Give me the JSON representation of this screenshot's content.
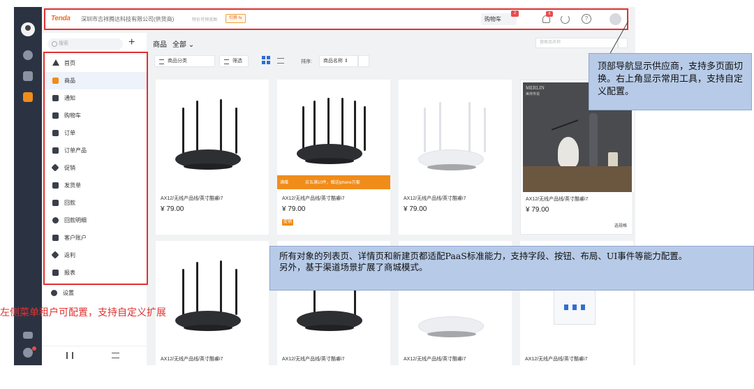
{
  "header": {
    "logo_text": "Tenda",
    "tenant_name": "深圳市吉祥腾达科技有限公司(供货商)",
    "tagline": "特价可预览图",
    "switch_label": "切换 ⇆",
    "cart_label": "购物车",
    "cart_count": "2",
    "bell_count": "8",
    "help_glyph": "?"
  },
  "sidebar": {
    "search_placeholder": "搜索",
    "add_glyph": "+",
    "items": [
      {
        "label": "首页",
        "icon": "home-icon"
      },
      {
        "label": "商品",
        "icon": "product-icon"
      },
      {
        "label": "通知",
        "icon": "notice-icon"
      },
      {
        "label": "购物车",
        "icon": "cart-icon"
      },
      {
        "label": "订单",
        "icon": "order-icon"
      },
      {
        "label": "订单产品",
        "icon": "order-product-icon"
      },
      {
        "label": "促销",
        "icon": "tag-icon"
      },
      {
        "label": "发货单",
        "icon": "shipment-icon"
      },
      {
        "label": "回款",
        "icon": "mail-icon"
      },
      {
        "label": "回款明细",
        "icon": "gear-icon"
      },
      {
        "label": "客户账户",
        "icon": "account-icon"
      },
      {
        "label": "返利",
        "icon": "tag-icon"
      },
      {
        "label": "报表",
        "icon": "report-icon"
      }
    ],
    "active_index": 1,
    "settings_label": "设置"
  },
  "content": {
    "crumb_title": "商品",
    "crumb_all": "全部 ⌄",
    "search_placeholder": "搜索品名称",
    "category_button": "商品分类",
    "filter_button": "筛选",
    "sort_label": "排序:",
    "sort_value": "商品名称 ⇕",
    "products": [
      {
        "name": "AX12/无线产品线/英寸酷睿i7",
        "price": "¥ 79.00",
        "promo": "",
        "banner": [],
        "spec": ""
      },
      {
        "name": "AX12/无线产品线/英寸酷睿i7",
        "price": "¥ 79.00",
        "promo": "促销",
        "banner": [
          "满赠",
          "买五满10件，赠送iphone万套"
        ],
        "spec": ""
      },
      {
        "name": "AX12/无线产品线/英寸酷睿i7",
        "price": "¥ 79.00",
        "promo": "",
        "banner": [],
        "spec": ""
      },
      {
        "name": "AX12/无线产品线/英寸酷睿i7",
        "price": "¥ 79.00",
        "promo": "",
        "banner": [],
        "spec": "选规格"
      },
      {
        "name": "AX12/无线产品线/英寸酷睿i7",
        "price": "",
        "promo": "",
        "banner": [],
        "spec": ""
      },
      {
        "name": "AX12/无线产品线/英寸酷睿i7",
        "price": "",
        "promo": "",
        "banner": [],
        "spec": ""
      },
      {
        "name": "AX12/无线产品线/英寸酷睿i7",
        "price": "",
        "promo": "",
        "banner": [],
        "spec": ""
      },
      {
        "name": "AX12/无线产品线/英寸酷睿i7",
        "price": "",
        "promo": "",
        "banner": [],
        "spec": ""
      }
    ],
    "photo_brand": "MERLIN",
    "photo_brand_sub": "美林传说"
  },
  "annotations": {
    "top_note": "顶部导航显示供应商，支持多页面切换。右上角显示常用工具，支持自定义配置。",
    "middle_note": [
      "所有对象的列表页、详情页和新建页都适配PaaS标准能力，支持字段、按钮、布局、UI事件等能力配置。",
      "另外，基于渠道场景扩展了商城模式。"
    ],
    "left_note": "左侧菜单租户可配置，支持自定义扩展"
  },
  "colors": {
    "highlight_red": "#e03131",
    "accent_orange": "#f08c1a",
    "rail_dark": "#2b3342",
    "note_blue": "#b7cbe8"
  }
}
